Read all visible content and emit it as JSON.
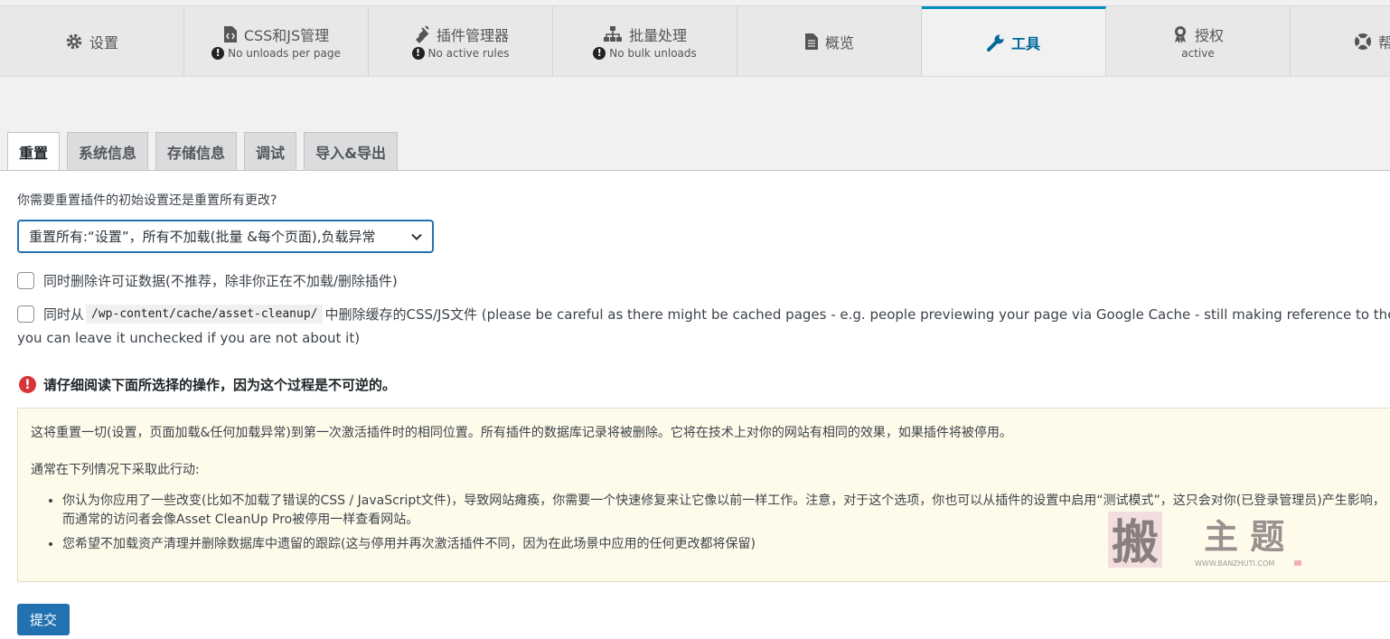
{
  "nav": {
    "tabs": [
      {
        "label": "设置",
        "sub": "",
        "icon": "gear-icon"
      },
      {
        "label": "CSS和JS管理",
        "sub": "No unloads per page",
        "icon": "code-file-icon"
      },
      {
        "label": "插件管理器",
        "sub": "No active rules",
        "icon": "plug-icon"
      },
      {
        "label": "批量处理",
        "sub": "No bulk unloads",
        "icon": "sitemap-icon"
      },
      {
        "label": "概览",
        "sub": "",
        "icon": "document-icon"
      },
      {
        "label": "工具",
        "sub": "",
        "icon": "wrench-icon"
      },
      {
        "label": "授权",
        "sub": "active",
        "icon": "award-icon"
      },
      {
        "label": "帮",
        "sub": "",
        "icon": "lifebuoy-icon"
      }
    ],
    "active_index": 5,
    "accent_color": "#008ec2"
  },
  "subtabs": [
    "重置",
    "系统信息",
    "存储信息",
    "调试",
    "导入&导出"
  ],
  "reset": {
    "question": "你需要重置插件的初始设置还是重置所有更改?",
    "select_value": "重置所有:“设置”，所有不加载(批量 &每个页面),负载异常",
    "checkbox1_label": "同时删除许可证数据(不推荐，除非你正在不加载/删除插件)",
    "checkbox2_prefix": "同时从",
    "checkbox2_path": "/wp-content/cache/asset-cleanup/",
    "checkbox2_suffix": "中删除缓存的CSS/JS文件 (please be careful as there might be cached pages - e.g. people previewing your page via Google Cache - still making reference to the CSS/JS f",
    "checkbox2_line2": "you can leave it unchecked if you are not about it)",
    "warning": "请仔细阅读下面所选择的操作，因为这个过程是不可逆的。",
    "notice_p1": "这将重置一切(设置，页面加载&任何加载异常)到第一次激活插件时的相同位置。所有插件的数据库记录将被删除。它将在技术上对你的网站有相同的效果，如果插件将被停用。",
    "notice_p2": "通常在下列情况下采取此行动:",
    "bullets": [
      "你认为你应用了一些改变(比如不加载了错误的CSS / JavaScript文件)，导致网站瘫痪，你需要一个快速修复来让它像以前一样工作。注意，对于这个选项，你也可以从插件的设置中启用“测试模式”，这只会对你(已登录管理员)产生影响，而通常的访问者会像Asset CleanUp Pro被停用一样查看网站。",
      "您希望不加载资产清理并删除数据库中遗留的跟踪(这与停用并再次激活插件不同，因为在此场景中应用的任何更改都将保留)"
    ],
    "submit_label": "提交"
  },
  "watermark": {
    "text": "搬主题",
    "url": "WWW.BANZHUTI.COM"
  }
}
